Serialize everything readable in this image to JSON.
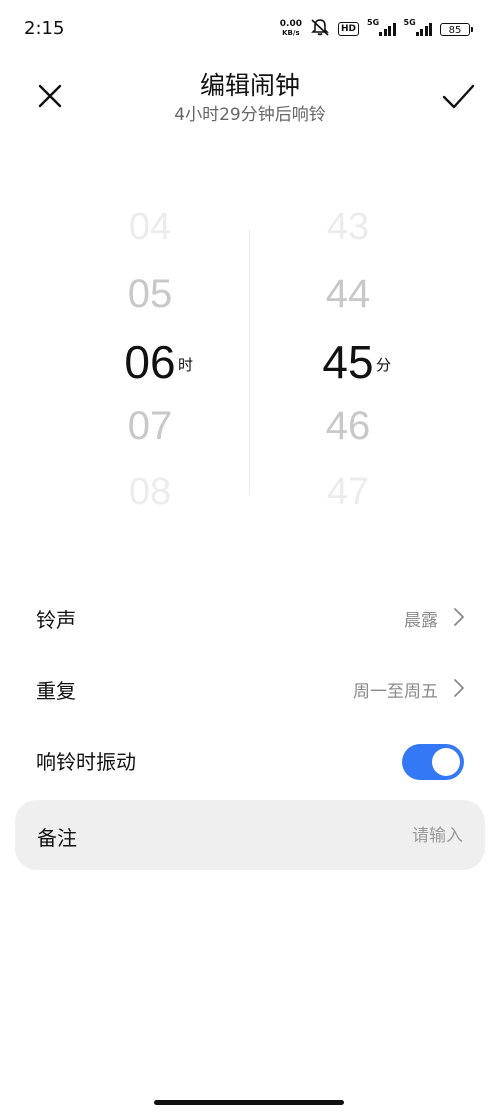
{
  "status": {
    "time": "2:15",
    "net_speed_value": "0.00",
    "net_speed_unit": "KB/s",
    "hd": "HD",
    "signal1_tag": "5G",
    "signal2_tag": "5G",
    "battery": "85",
    "icons": [
      "alarm-muted-icon",
      "hd-icon",
      "signal-icon",
      "battery-icon"
    ]
  },
  "header": {
    "title": "编辑闹钟",
    "subtitle": "4小时29分钟后响铃",
    "close_icon": "close-icon",
    "confirm_icon": "check-icon"
  },
  "picker": {
    "hours": [
      "04",
      "05",
      "06",
      "07",
      "08"
    ],
    "minutes": [
      "43",
      "44",
      "45",
      "46",
      "47"
    ],
    "hour_unit": "时",
    "minute_unit": "分"
  },
  "settings": {
    "ringtone": {
      "label": "铃声",
      "value": "晨露"
    },
    "repeat": {
      "label": "重复",
      "value": "周一至周五"
    },
    "vibrate": {
      "label": "响铃时振动",
      "enabled": true
    }
  },
  "note": {
    "label": "备注",
    "placeholder": "请输入"
  },
  "colors": {
    "accent": "#3478f6",
    "card": "#efefef"
  }
}
